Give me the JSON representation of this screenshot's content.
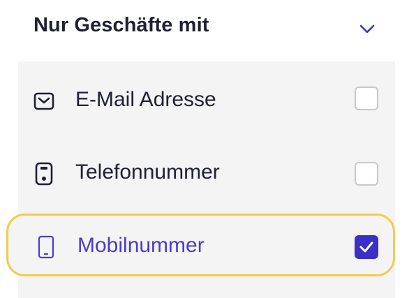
{
  "filter": {
    "title": "Nur Geschäfte mit",
    "expanded": true,
    "icons": {
      "toggle": "chevron-down-icon"
    },
    "accent_color": "#3b2fc9",
    "highlight_color": "#f6c94a",
    "options": [
      {
        "label": "E-Mail Adresse",
        "icon": "envelope-icon",
        "checked": false
      },
      {
        "label": "Telefonnummer",
        "icon": "landline-phone-icon",
        "checked": false
      },
      {
        "label": "Mobilnummer",
        "icon": "mobile-phone-icon",
        "checked": true
      }
    ]
  }
}
